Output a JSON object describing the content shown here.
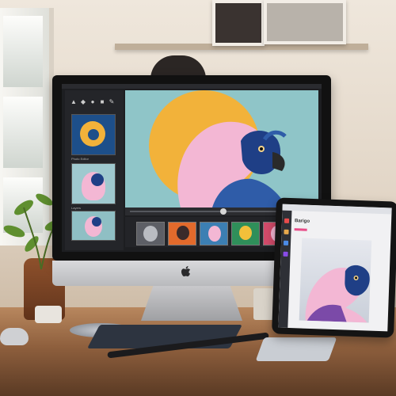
{
  "scene": "desk-with-imac-and-tablet-photo-editing",
  "icons": [
    "apple-logo-icon",
    "tool-icons"
  ],
  "colors": {
    "wall": "#e6dccf",
    "desk": "#9a6a45",
    "canvas_bg": "#8fc5c8",
    "sun": "#f2b23a",
    "bird_pink": "#f3b7d4",
    "bird_blue": "#1f3f86"
  },
  "editor": {
    "panel_label_1": "Photo Editor",
    "panel_label_2": "Layers",
    "tool_glyphs": [
      "▲",
      "◆",
      "●",
      "■",
      "✎",
      "◐"
    ]
  },
  "tablet": {
    "title": "Barigo"
  }
}
